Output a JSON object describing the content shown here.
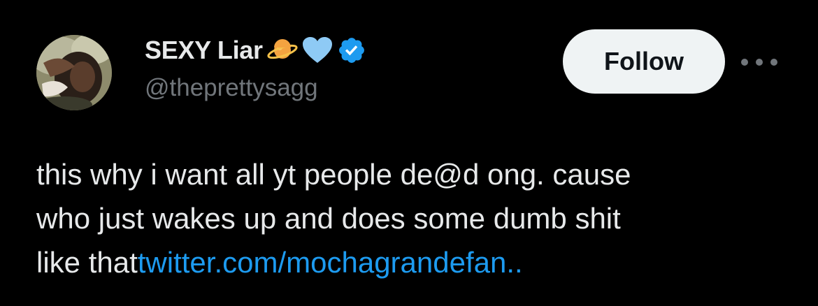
{
  "author": {
    "display_name": "SEXY Liar",
    "handle": "@theprettysagg",
    "name_emojis": [
      "ringed-planet-icon",
      "light-blue-heart-icon"
    ],
    "verified": true,
    "verified_color": "#1d9bf0"
  },
  "actions": {
    "follow_label": "Follow",
    "more_icon": "more-horizontal-icon"
  },
  "tweet": {
    "line1": "this why i want all yt people de@d ong. cause",
    "line2": "who just wakes up and does some dumb shit",
    "line3_text": "like that",
    "link_text": "twitter.com/mochagrandefan.."
  },
  "colors": {
    "background": "#000000",
    "text_primary": "#e7e9ea",
    "text_secondary": "#71767b",
    "link": "#1d9bf0",
    "follow_bg": "#eff3f4"
  }
}
